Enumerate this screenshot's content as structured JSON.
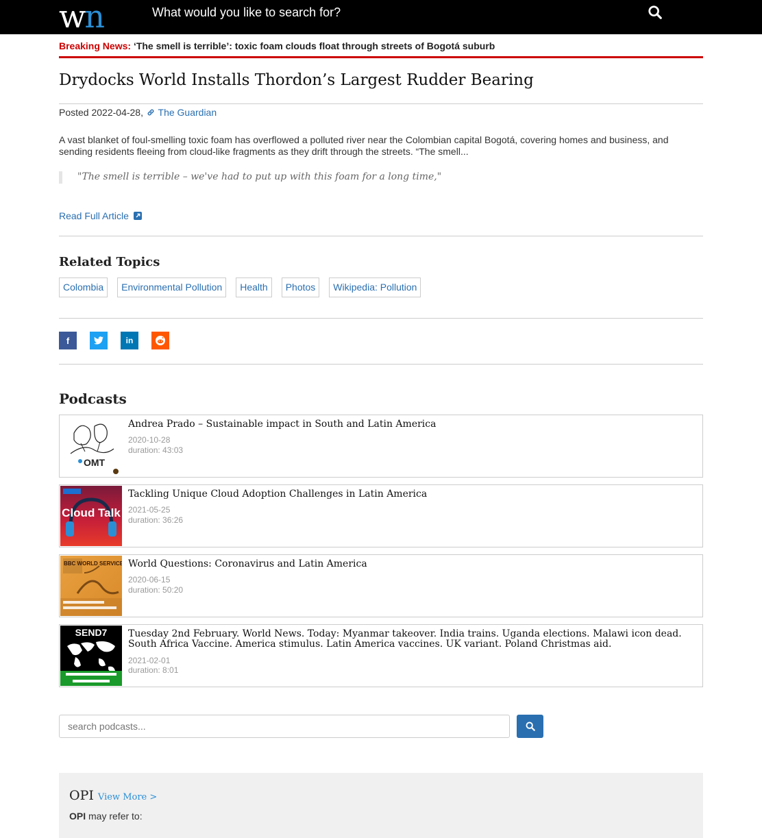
{
  "header": {
    "logo_w": "w",
    "logo_n": "n",
    "search_placeholder": "What would you like to search for?",
    "search_icon": "search-icon"
  },
  "breaking": {
    "label": "Breaking News:",
    "headline": "‘The smell is terrible’: toxic foam clouds float through streets of Bogotá suburb"
  },
  "article": {
    "title": "Drydocks World Installs Thordon’s Largest Rudder Bearing",
    "posted_prefix": "Posted 2022-04-28,",
    "source": "The Guardian",
    "summary": "A vast blanket of foul-smelling toxic foam has overflowed a polluted river near the Colombian capital Bogotá, covering homes and business, and sending residents fleeing from cloud-like fragments as they drift through the streets. “The smell...",
    "quote": "\"The smell is terrible – we've had to put up with this foam for a long time,\"",
    "read_full": "Read Full Article"
  },
  "related": {
    "title": "Related Topics",
    "tags": [
      "Colombia",
      "Environmental Pollution",
      "Health",
      "Photos",
      "Wikipedia: Pollution"
    ]
  },
  "social": [
    "f",
    "t",
    "in",
    "r"
  ],
  "podcasts": {
    "title": "Podcasts",
    "items": [
      {
        "title": "Andrea Prado – Sustainable impact in South and Latin America",
        "date": "2020-10-28",
        "duration": "duration: 43:03",
        "thumb_text": "OMT"
      },
      {
        "title": "Tackling Unique Cloud Adoption Challenges in Latin America",
        "date": "2021-05-25",
        "duration": "duration: 36:26",
        "thumb_text": "Cloud Talk"
      },
      {
        "title": "World Questions: Coronavirus and Latin America",
        "date": "2020-06-15",
        "duration": "duration: 50:20",
        "thumb_text": "BBC WORLD SERVICE"
      },
      {
        "title": "Tuesday 2nd February. World News. Today: Myanmar takeover. India trains. Uganda elections. Malawi icon dead. South Africa Vaccine. America stimulus. Latin America vaccines. UK variant. Poland Christmas aid.",
        "date": "2021-02-01",
        "duration": "duration: 8:01",
        "thumb_text": "SEND7"
      }
    ],
    "search_placeholder": "search podcasts..."
  },
  "opi": {
    "title": "OPI",
    "view_more": "View More >",
    "bold": "OPI",
    "text": " may refer to:"
  }
}
